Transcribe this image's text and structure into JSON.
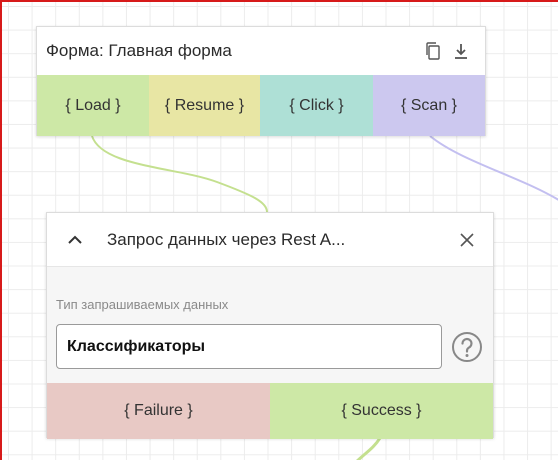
{
  "form_node": {
    "title": "Форма: Главная форма",
    "copy_icon": "copy-icon",
    "download_icon": "download-icon",
    "events": [
      {
        "label": "{ Load }",
        "color": "#cde8a6"
      },
      {
        "label": "{ Resume }",
        "color": "#e8e6a4"
      },
      {
        "label": "{ Click }",
        "color": "#aee0d6"
      },
      {
        "label": "{ Scan }",
        "color": "#ccc8ef"
      }
    ]
  },
  "request_node": {
    "collapse_icon": "chevron-up-icon",
    "title": "Запрос данных через Rest A...",
    "close_icon": "close-icon",
    "field_label": "Тип запрашиваемых данных",
    "field_value": "Классификаторы",
    "help_icon": "help-icon",
    "events": [
      {
        "label": "{ Failure }",
        "color": "#e8c9c5"
      },
      {
        "label": "{ Success }",
        "color": "#cde8a6"
      }
    ]
  },
  "colors": {
    "frame_border": "#d71a1a",
    "green_connector": "#c4e08f",
    "purple_connector": "#c3bff0"
  }
}
